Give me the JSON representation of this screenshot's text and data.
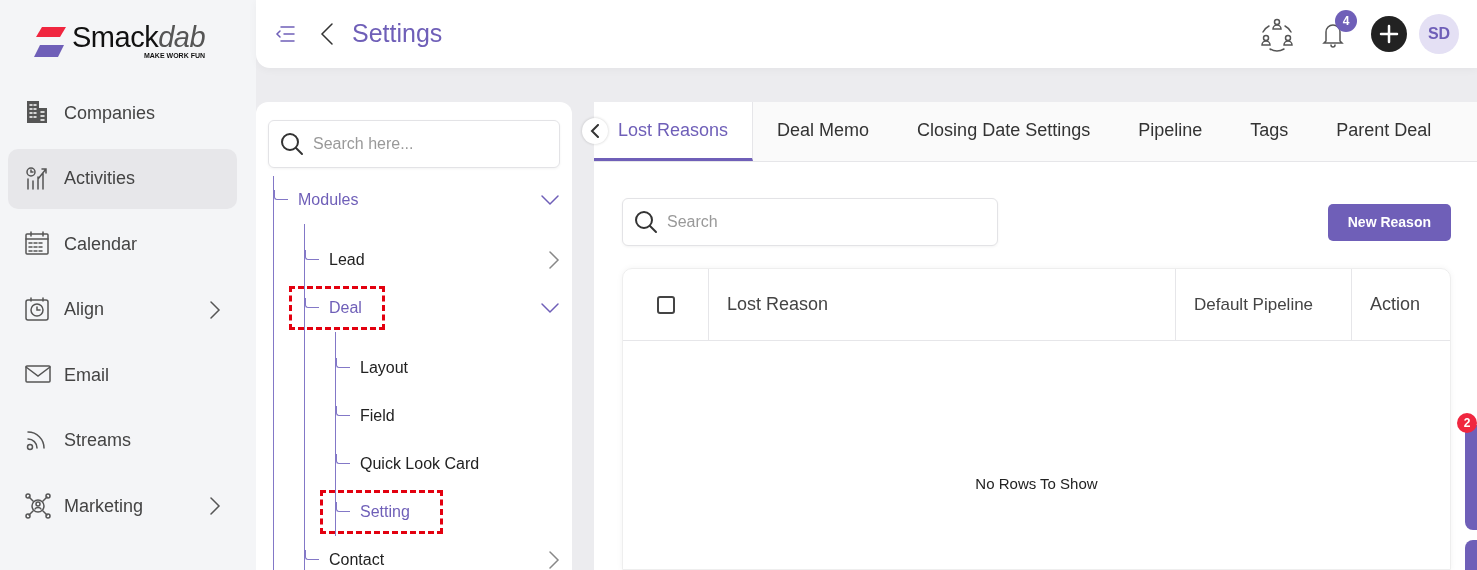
{
  "brand": {
    "name": "Smack",
    "name_accent": "dab",
    "tagline": "MAKE WORK FUN"
  },
  "sidebar": {
    "items": [
      {
        "label": "Companies",
        "selected": false,
        "has_submenu": false
      },
      {
        "label": "Activities",
        "selected": true,
        "has_submenu": false
      },
      {
        "label": "Calendar",
        "selected": false,
        "has_submenu": false
      },
      {
        "label": "Align",
        "selected": false,
        "has_submenu": true
      },
      {
        "label": "Email",
        "selected": false,
        "has_submenu": false
      },
      {
        "label": "Streams",
        "selected": false,
        "has_submenu": false
      },
      {
        "label": "Marketing",
        "selected": false,
        "has_submenu": true
      }
    ]
  },
  "header": {
    "title": "Settings",
    "notification_count": "4",
    "avatar_initials": "SD"
  },
  "tree": {
    "search_placeholder": "Search here...",
    "items": [
      {
        "label": "Modules",
        "selected": true,
        "expanded": true,
        "highlighted": false,
        "children": [
          {
            "label": "Lead",
            "selected": false,
            "expanded": false,
            "highlighted": false
          },
          {
            "label": "Deal",
            "selected": true,
            "expanded": true,
            "highlighted": true,
            "children": [
              {
                "label": "Layout",
                "selected": false,
                "highlighted": false
              },
              {
                "label": "Field",
                "selected": false,
                "highlighted": false
              },
              {
                "label": "Quick Look Card",
                "selected": false,
                "highlighted": false
              },
              {
                "label": "Setting",
                "selected": true,
                "highlighted": true
              }
            ]
          },
          {
            "label": "Contact",
            "selected": false,
            "expanded": false,
            "highlighted": false
          }
        ]
      }
    ]
  },
  "tabs": [
    {
      "label": "Lost Reasons",
      "selected": true
    },
    {
      "label": "Deal Memo",
      "selected": false
    },
    {
      "label": "Closing Date Settings",
      "selected": false
    },
    {
      "label": "Pipeline",
      "selected": false
    },
    {
      "label": "Tags",
      "selected": false
    },
    {
      "label": "Parent Deal",
      "selected": false
    }
  ],
  "content": {
    "search_placeholder": "Search",
    "new_button": "New Reason",
    "table": {
      "select_all_checked": false,
      "columns": [
        "Lost Reason",
        "Default Pipeline",
        "Action"
      ],
      "empty_message": "No Rows To Show"
    }
  },
  "side_tab_badge": "2"
}
